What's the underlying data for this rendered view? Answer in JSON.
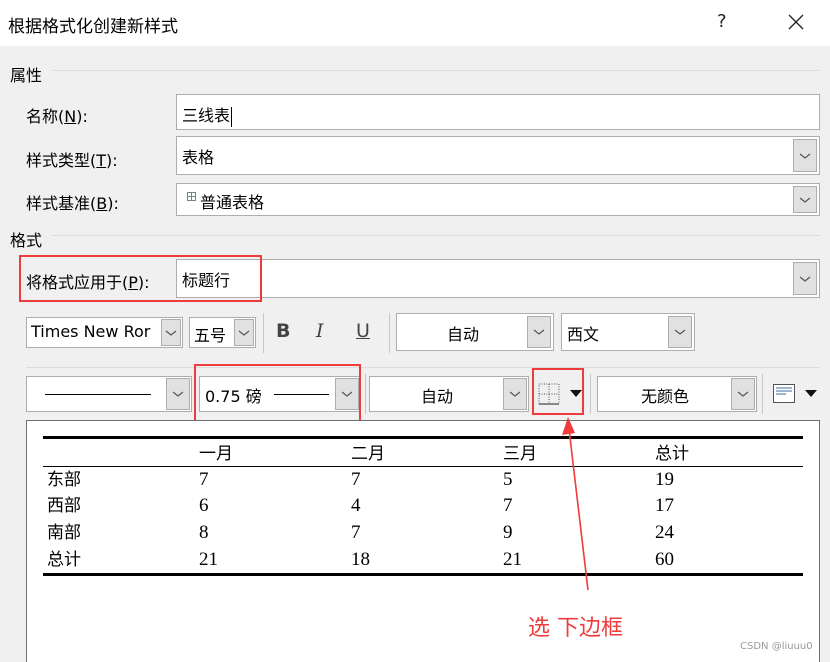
{
  "dialog": {
    "title": "根据格式化创建新样式",
    "help_label": "?",
    "close_icon": "close-icon"
  },
  "properties": {
    "section_label": "属性",
    "name_label": "名称(",
    "name_key": "N",
    "name_suffix": "):",
    "name_value": "三线表",
    "type_label": "样式类型(",
    "type_key": "T",
    "type_suffix": "):",
    "type_value": "表格",
    "base_label": "样式基准(",
    "base_key": "B",
    "base_suffix": "):",
    "base_value": "普通表格",
    "base_icon": "table-style-icon"
  },
  "format": {
    "section_label": "格式",
    "apply_label": "将格式应用于(",
    "apply_key": "P",
    "apply_suffix": "):",
    "apply_value": "标题行",
    "font_value": "Times New Ror",
    "size_value": "五号",
    "bold_label": "B",
    "italic_label": "I",
    "underline_label": "U",
    "color_value": "自动",
    "script_value": "西文",
    "line_width_value": "0.75 磅",
    "border_color_value": "自动",
    "shading_value": "无颜色"
  },
  "preview": {
    "headers": [
      "",
      "一月",
      "二月",
      "三月",
      "总计"
    ],
    "rows": [
      [
        "东部",
        "7",
        "7",
        "5",
        "19"
      ],
      [
        "西部",
        "6",
        "4",
        "7",
        "17"
      ],
      [
        "南部",
        "8",
        "7",
        "9",
        "24"
      ],
      [
        "总计",
        "21",
        "18",
        "21",
        "60"
      ]
    ]
  },
  "annotation": {
    "text": "选 下边框",
    "color": "#ee3b3b"
  },
  "watermark": "CSDN @liuuu0"
}
